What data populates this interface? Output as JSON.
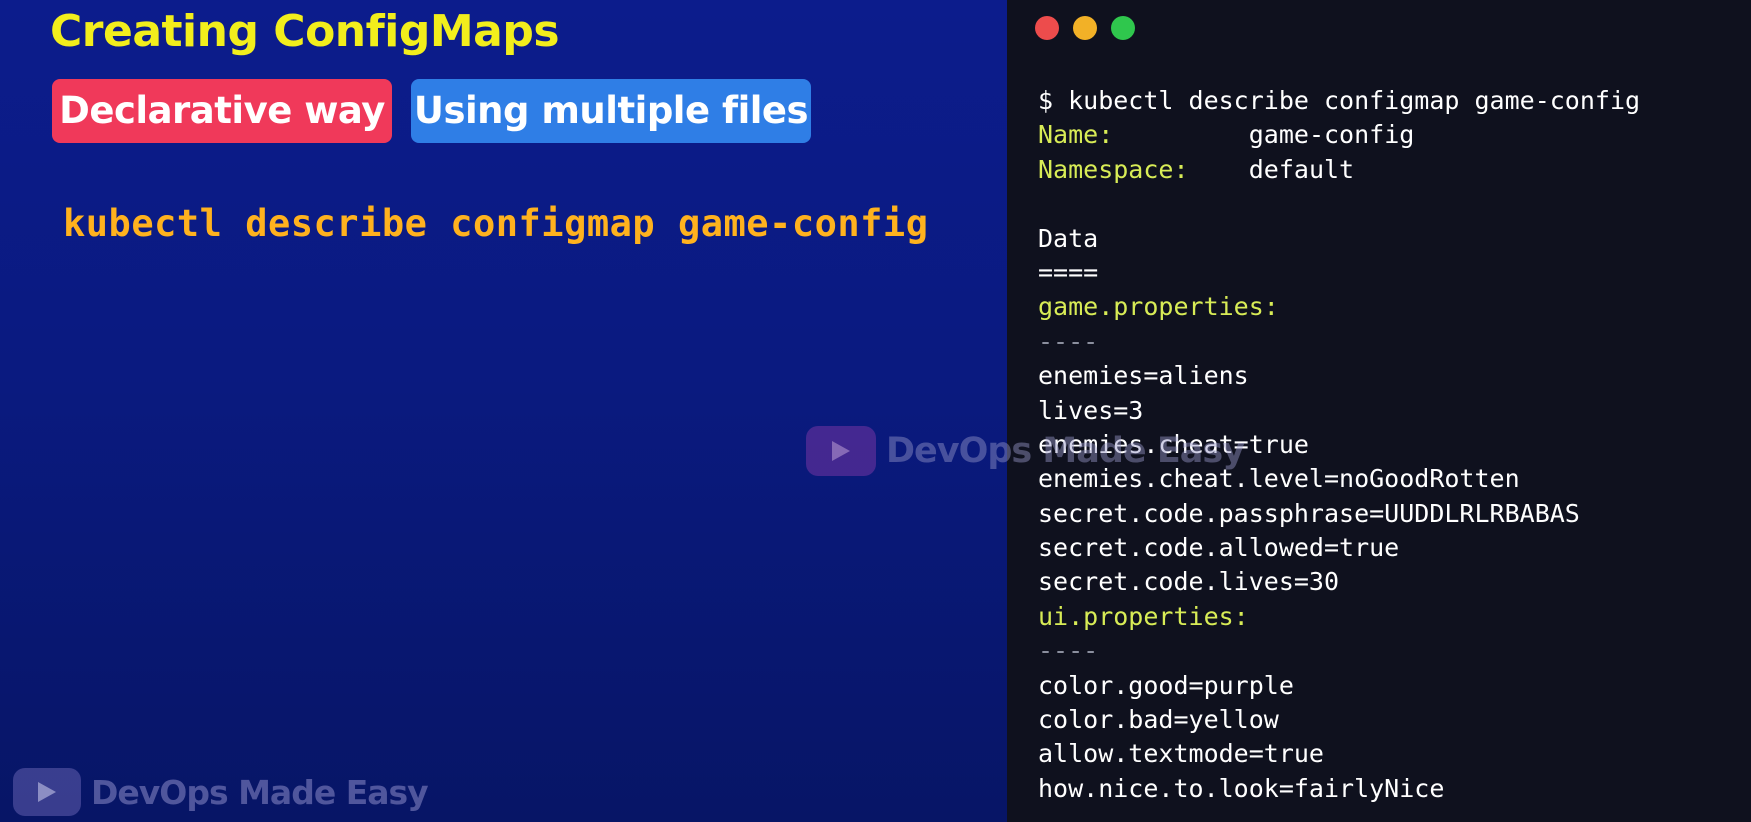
{
  "slide": {
    "title": "Creating ConfigMaps",
    "tags": [
      {
        "label": "Declarative way",
        "color": "#f0395a"
      },
      {
        "label": "Using multiple files",
        "color": "#2f7ee6"
      }
    ],
    "command": "kubectl describe configmap game-config"
  },
  "watermark": {
    "text": "DevOps Made Easy",
    "icon": "play-icon"
  },
  "terminal": {
    "window_controls": [
      "close-dot",
      "minimize-dot",
      "maximize-dot"
    ],
    "lines": [
      {
        "text": "$ kubectl describe configmap game-config",
        "style": "c-white"
      },
      {
        "text": "Name:         game-config",
        "style": "c-yellow-key",
        "key": "Name:",
        "value": "game-config"
      },
      {
        "text": "Namespace:    default",
        "style": "c-yellow-key",
        "key": "Namespace:",
        "value": "default"
      },
      {
        "text": "",
        "style": "c-white"
      },
      {
        "text": "Data",
        "style": "c-white"
      },
      {
        "text": "====",
        "style": "c-white"
      },
      {
        "text": "game.properties:",
        "style": "c-yellow"
      },
      {
        "text": "----",
        "style": "c-gray"
      },
      {
        "text": "enemies=aliens",
        "style": "c-white"
      },
      {
        "text": "lives=3",
        "style": "c-white"
      },
      {
        "text": "enemies.cheat=true",
        "style": "c-white"
      },
      {
        "text": "enemies.cheat.level=noGoodRotten",
        "style": "c-white"
      },
      {
        "text": "secret.code.passphrase=UUDDLRLRBABAS",
        "style": "c-white"
      },
      {
        "text": "secret.code.allowed=true",
        "style": "c-white"
      },
      {
        "text": "secret.code.lives=30",
        "style": "c-white"
      },
      {
        "text": "ui.properties:",
        "style": "c-yellow"
      },
      {
        "text": "----",
        "style": "c-gray"
      },
      {
        "text": "color.good=purple",
        "style": "c-white"
      },
      {
        "text": "color.bad=yellow",
        "style": "c-white"
      },
      {
        "text": "allow.textmode=true",
        "style": "c-white"
      },
      {
        "text": "how.nice.to.look=fairlyNice",
        "style": "c-white"
      }
    ]
  },
  "colors": {
    "title": "#f2ee1c",
    "command": "#ffb21e",
    "terminal_bg": "#0f111e",
    "terminal_key": "#d8ec56",
    "background": "#0c1c8c"
  }
}
